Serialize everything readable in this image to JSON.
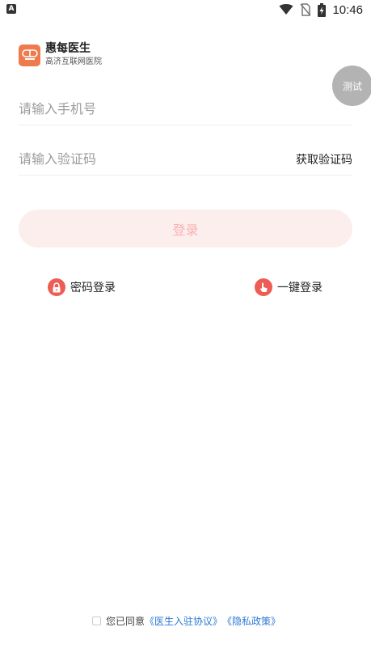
{
  "status_bar": {
    "time": "10:46",
    "icons": [
      "notification-a-icon",
      "wifi-icon",
      "no-sim-icon",
      "battery-charging-icon"
    ]
  },
  "brand": {
    "logo_icon": "hospital-logo-icon",
    "name": "惠每医生",
    "subtitle": "高济互联网医院"
  },
  "floating": {
    "test_label": "测试"
  },
  "form": {
    "phone_placeholder": "请输入手机号",
    "code_placeholder": "请输入验证码",
    "get_code_label": "获取验证码",
    "login_label": "登录"
  },
  "alt_logins": {
    "password": {
      "icon": "lock-icon",
      "label": "密码登录"
    },
    "onekey": {
      "icon": "tap-icon",
      "label": "一键登录"
    }
  },
  "agreement": {
    "prefix": "您已同意",
    "doctor_agreement": "《医生入驻协议》",
    "privacy_policy": "《隐私政策》"
  },
  "colors": {
    "accent": "#ee5d55",
    "login_bg_disabled": "#fdeeee",
    "link": "#2d7ad6",
    "logo": "#ef7a4d"
  }
}
